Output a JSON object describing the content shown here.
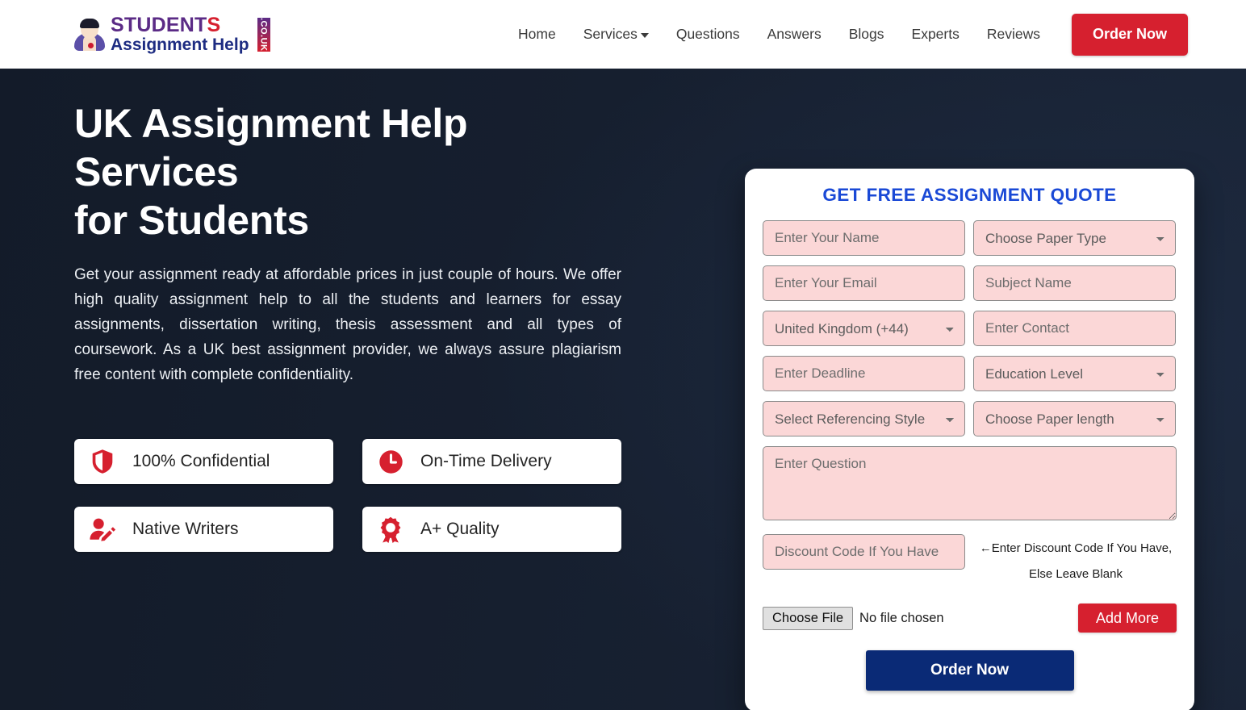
{
  "brand": {
    "name_part1": "STUDENT",
    "name_part2": "S",
    "name_line2": "Assignment Help",
    "tld": ".CO.UK",
    "accent_purple": "#5b2b86",
    "accent_red": "#d6202f",
    "accent_blue": "#1d2c82"
  },
  "nav": {
    "items": [
      {
        "label": "Home",
        "has_caret": false
      },
      {
        "label": "Services",
        "has_caret": true
      },
      {
        "label": "Questions",
        "has_caret": false
      },
      {
        "label": "Answers",
        "has_caret": false
      },
      {
        "label": "Blogs",
        "has_caret": false
      },
      {
        "label": "Experts",
        "has_caret": false
      },
      {
        "label": "Reviews",
        "has_caret": false
      }
    ],
    "cta_label": "Order Now"
  },
  "hero": {
    "title_line1": "UK Assignment Help Services",
    "title_line2": "for Students",
    "paragraph": "Get your assignment ready at affordable prices in just couple of hours. We offer high quality assignment help to all the students and learners for essay assignments, dissertation writing, thesis assessment and all types of coursework. As a UK best assignment provider, we always assure plagiarism free content with complete confidentiality.",
    "features": [
      {
        "label": "100% Confidential",
        "icon": "shield-icon"
      },
      {
        "label": "On-Time Delivery",
        "icon": "clock-icon"
      },
      {
        "label": "Native Writers",
        "icon": "user-edit-icon"
      },
      {
        "label": "A+ Quality",
        "icon": "award-ribbon-icon"
      }
    ]
  },
  "form": {
    "title": "GET FREE ASSIGNMENT QUOTE",
    "name_placeholder": "Enter Your Name",
    "paper_type_value": "Choose Paper Type",
    "email_placeholder": "Enter Your Email",
    "subject_placeholder": "Subject Name",
    "country_code_value": "United Kingdom (+44)",
    "contact_placeholder": "Enter Contact",
    "deadline_placeholder": "Enter Deadline",
    "education_level_value": "Education Level",
    "referencing_style_value": "Select Referencing Style",
    "paper_length_value": "Choose Paper length",
    "question_placeholder": "Enter Question",
    "discount_placeholder": "Discount Code If You Have",
    "discount_note_arrow": "←",
    "discount_note_line1": "Enter Discount Code If You Have,",
    "discount_note_line2": "Else Leave Blank",
    "choose_file_label": "Choose File",
    "file_status": "No file chosen",
    "add_more_label": "Add More",
    "submit_label": "Order Now",
    "field_bg": "#fbd7d7",
    "title_color": "#1a49d6",
    "submit_color": "#0a2a76"
  }
}
